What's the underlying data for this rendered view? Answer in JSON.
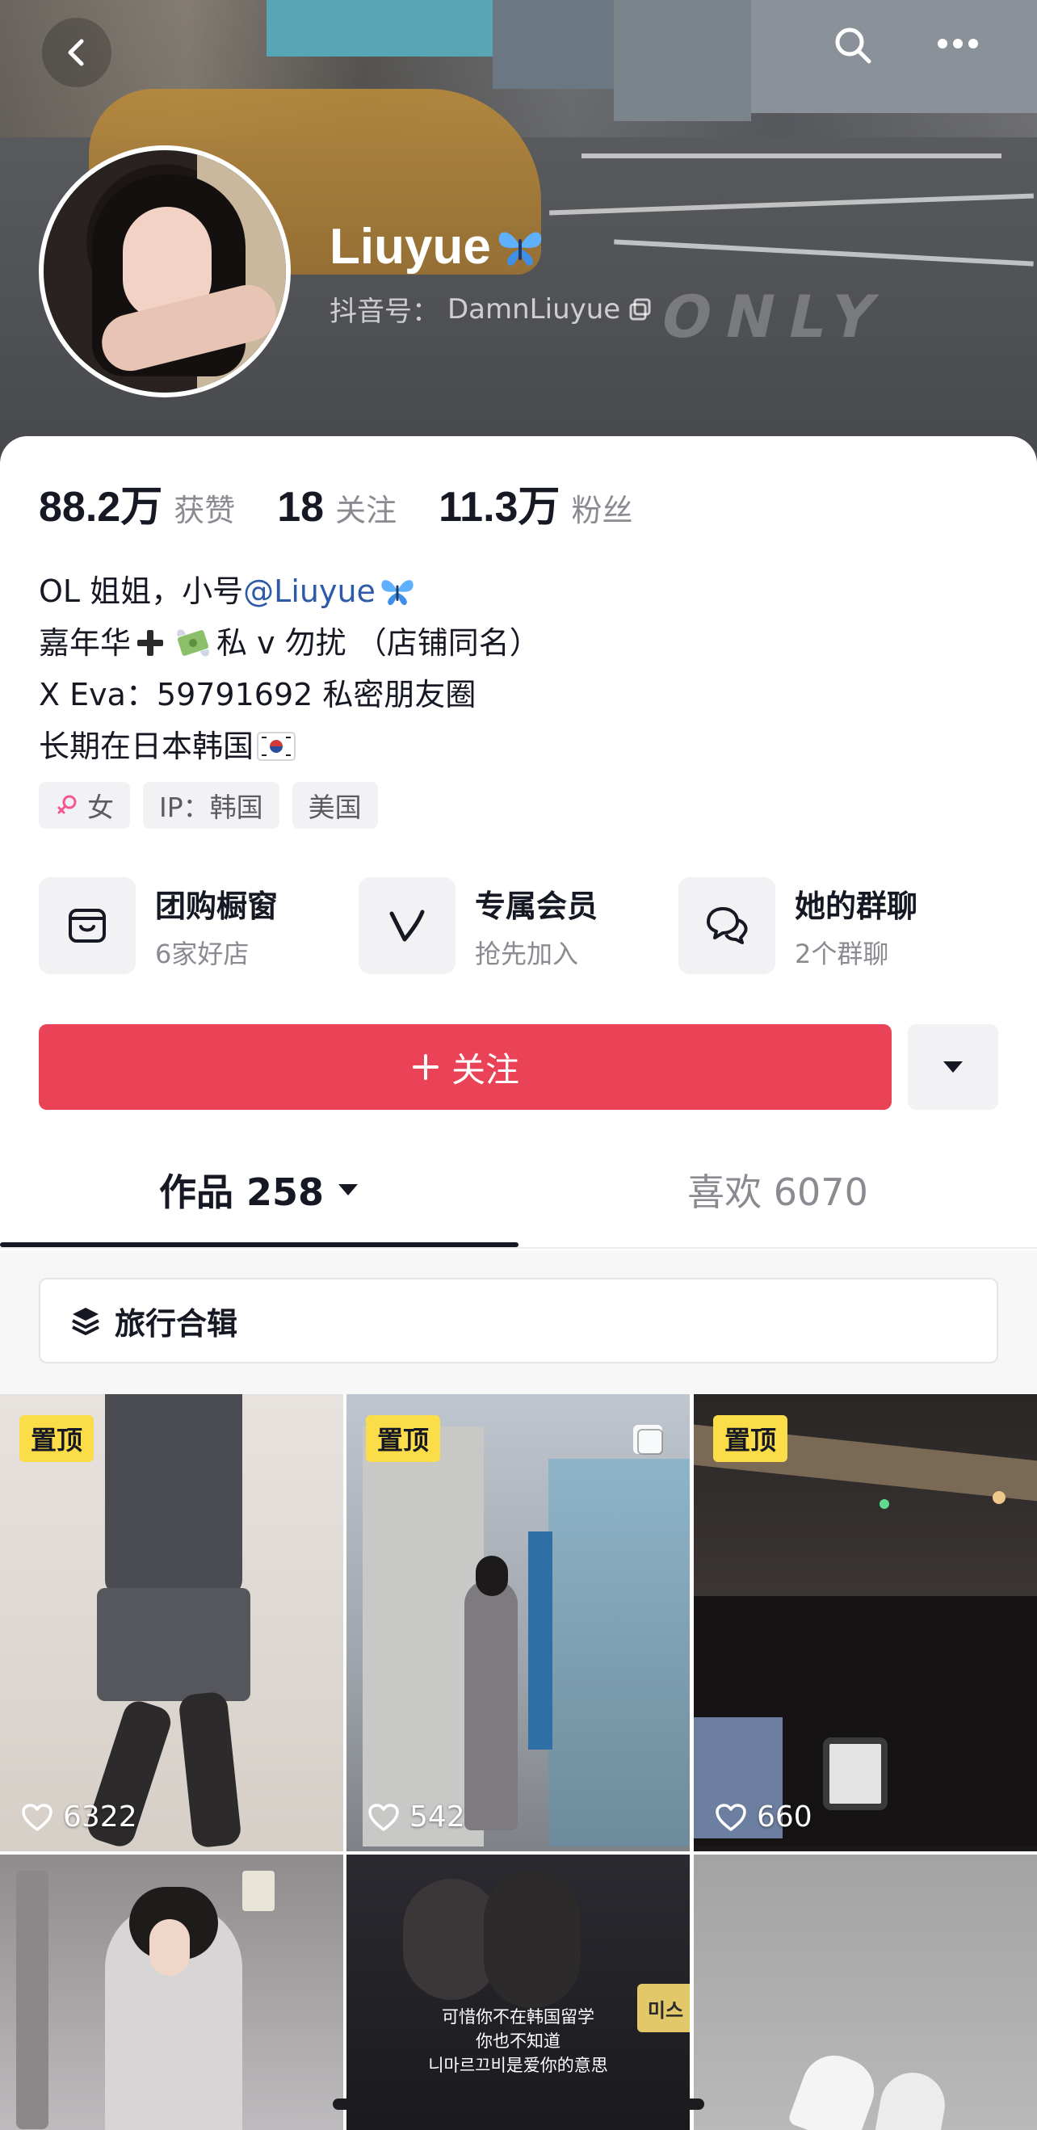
{
  "header": {
    "back_icon": "chevron-left-icon",
    "search_icon": "search-icon",
    "more_icon": "more-dots-icon",
    "name": "Liuyue",
    "name_emoji": "blue-butterfly",
    "douyin_id_label": "抖音号：",
    "douyin_id": "DamnLiuyue",
    "copy_icon": "copy-icon",
    "cover_watermark": "ONLY"
  },
  "stats": [
    {
      "num": "88.2万",
      "label": "获赞"
    },
    {
      "num": "18",
      "label": "关注"
    },
    {
      "num": "11.3万",
      "label": "粉丝"
    }
  ],
  "bio": {
    "line1_text": "OL 姐姐，小号 ",
    "line1_mention": "@Liuyue",
    "line2_a": "嘉年华",
    "line2_b": "私 v 勿扰 （店铺同名）",
    "line3": "X Eva：59791692 私密朋友圈",
    "line4": "长期在日本韩国"
  },
  "tags": [
    {
      "icon": "female-icon",
      "label": "女"
    },
    {
      "label": "IP：韩国"
    },
    {
      "label": "美国"
    }
  ],
  "features": [
    {
      "icon": "shop-window-icon",
      "title": "团购橱窗",
      "sub": "6家好店"
    },
    {
      "icon": "member-v-icon",
      "title": "专属会员",
      "sub": "抢先加入"
    },
    {
      "icon": "group-chat-icon",
      "title": "她的群聊",
      "sub": "2个群聊"
    }
  ],
  "follow": {
    "label": "关注",
    "plus": "+"
  },
  "tabs": {
    "works_label": "作品 258",
    "likes_label": "喜欢 6070"
  },
  "collection": {
    "label": "旅行合辑"
  },
  "videos": [
    {
      "pinned": "置顶",
      "likes": "6322"
    },
    {
      "pinned": "置顶",
      "likes": "542"
    },
    {
      "pinned": "置顶",
      "likes": "660"
    },
    {
      "likes": ""
    },
    {
      "caption_1": "可惜你不在韩国留学",
      "caption_2": "你也不知道",
      "caption_3": "니마르끄비是爱你的意思",
      "sign": "미스"
    },
    {
      "likes": ""
    }
  ],
  "colors": {
    "follow_red": "#ea4256",
    "pin_yellow": "#fbdc49",
    "mention_blue": "#2f5aa8",
    "gray_text": "#8a8b91"
  }
}
